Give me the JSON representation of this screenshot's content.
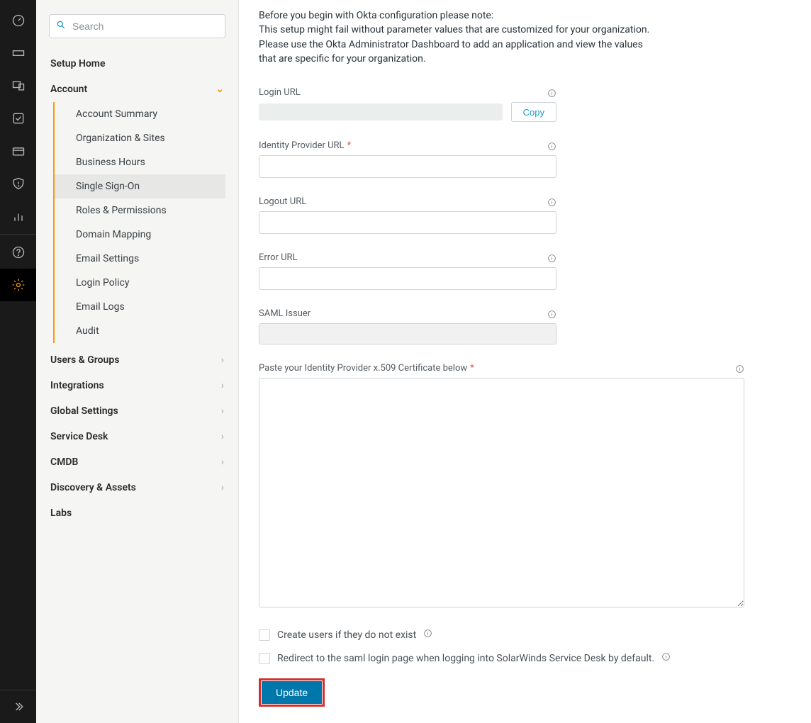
{
  "sidebar": {
    "search_placeholder": "Search",
    "setup_home": "Setup Home",
    "account": {
      "label": "Account",
      "items": [
        "Account Summary",
        "Organization & Sites",
        "Business Hours",
        "Single Sign-On",
        "Roles & Permissions",
        "Domain Mapping",
        "Email Settings",
        "Login Policy",
        "Email Logs",
        "Audit"
      ],
      "active_index": 3
    },
    "sections": [
      "Users & Groups",
      "Integrations",
      "Global Settings",
      "Service Desk",
      "CMDB",
      "Discovery & Assets",
      "Labs"
    ]
  },
  "main": {
    "intro": "Before you begin with Okta configuration please note:\nThis setup might fail without parameter values that are customized for your organization. Please use the Okta Administrator Dashboard to add an application and view the values that are specific for your organization.",
    "login_url_label": "Login URL",
    "copy_label": "Copy",
    "idp_url_label": "Identity Provider URL",
    "logout_url_label": "Logout URL",
    "error_url_label": "Error URL",
    "saml_issuer_label": "SAML Issuer",
    "cert_label": "Paste your Identity Provider x.509 Certificate below",
    "create_users_label": "Create users if they do not exist",
    "redirect_label": "Redirect to the saml login page when logging into SolarWinds Service Desk by default.",
    "update_label": "Update",
    "values": {
      "login_url": "",
      "idp_url": "",
      "logout_url": "",
      "error_url": "",
      "saml_issuer": "",
      "certificate": ""
    }
  }
}
